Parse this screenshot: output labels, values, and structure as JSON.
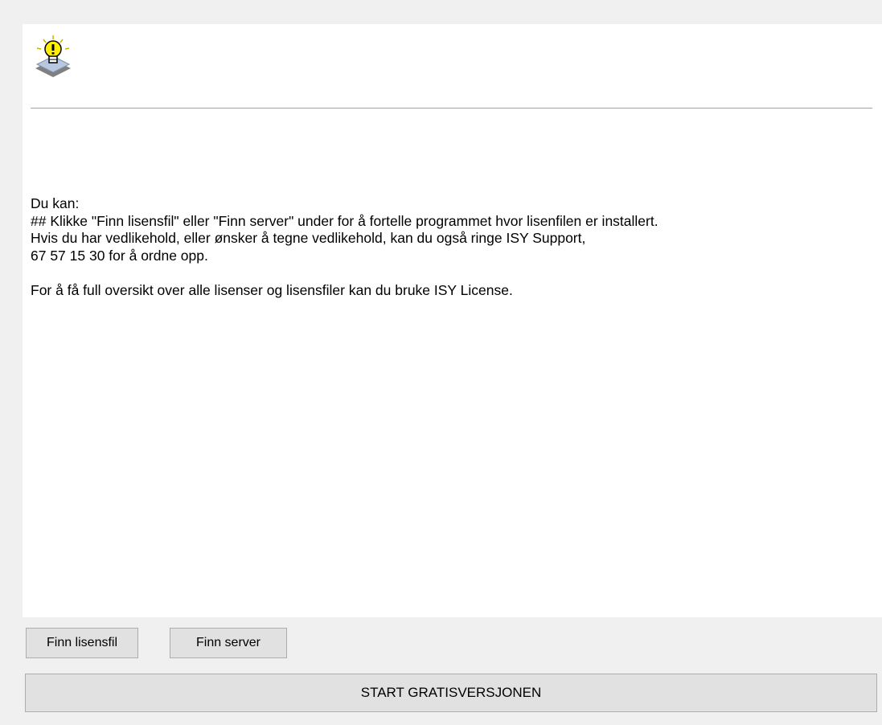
{
  "content": {
    "icon": "lightbulb-icon",
    "lines": [
      "Du kan:",
      "## Klikke \"Finn lisensfil\" eller \"Finn server\" under for å fortelle programmet hvor lisenfilen er installert.",
      "Hvis du har vedlikehold, eller ønsker å tegne vedlikehold, kan du også ringe ISY Support,",
      "67 57 15 30 for å ordne opp.",
      "For å få full oversikt over alle lisenser og lisensfiler kan du bruke ISY License."
    ]
  },
  "buttons": {
    "finn_lisensfil": "Finn lisensfil",
    "finn_server": "Finn server",
    "start": "START GRATISVERSJONEN"
  },
  "colors": {
    "background": "#f0f0f0",
    "panel": "#ffffff",
    "button": "#e1e1e1",
    "button_border": "#adadad"
  }
}
